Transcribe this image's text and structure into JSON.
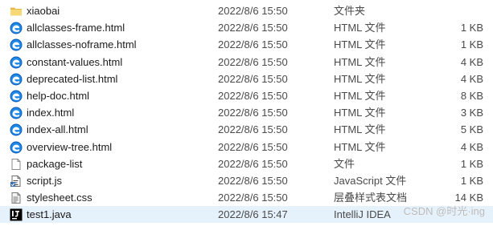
{
  "files": [
    {
      "name": "xiaobai",
      "date": "2022/8/6 15:50",
      "type": "文件夹",
      "size": "",
      "icon": "folder-icon"
    },
    {
      "name": "allclasses-frame.html",
      "date": "2022/8/6 15:50",
      "type": "HTML 文件",
      "size": "1 KB",
      "icon": "edge-html-icon"
    },
    {
      "name": "allclasses-noframe.html",
      "date": "2022/8/6 15:50",
      "type": "HTML 文件",
      "size": "1 KB",
      "icon": "edge-html-icon"
    },
    {
      "name": "constant-values.html",
      "date": "2022/8/6 15:50",
      "type": "HTML 文件",
      "size": "4 KB",
      "icon": "edge-html-icon"
    },
    {
      "name": "deprecated-list.html",
      "date": "2022/8/6 15:50",
      "type": "HTML 文件",
      "size": "4 KB",
      "icon": "edge-html-icon"
    },
    {
      "name": "help-doc.html",
      "date": "2022/8/6 15:50",
      "type": "HTML 文件",
      "size": "8 KB",
      "icon": "edge-html-icon"
    },
    {
      "name": "index.html",
      "date": "2022/8/6 15:50",
      "type": "HTML 文件",
      "size": "3 KB",
      "icon": "edge-html-icon"
    },
    {
      "name": "index-all.html",
      "date": "2022/8/6 15:50",
      "type": "HTML 文件",
      "size": "5 KB",
      "icon": "edge-html-icon"
    },
    {
      "name": "overview-tree.html",
      "date": "2022/8/6 15:50",
      "type": "HTML 文件",
      "size": "4 KB",
      "icon": "edge-html-icon"
    },
    {
      "name": "package-list",
      "date": "2022/8/6 15:50",
      "type": "文件",
      "size": "1 KB",
      "icon": "blank-file-icon"
    },
    {
      "name": "script.js",
      "date": "2022/8/6 15:50",
      "type": "JavaScript 文件",
      "size": "1 KB",
      "icon": "script-file-icon"
    },
    {
      "name": "stylesheet.css",
      "date": "2022/8/6 15:50",
      "type": "层叠样式表文档",
      "size": "14 KB",
      "icon": "css-file-icon"
    },
    {
      "name": "test1.java",
      "date": "2022/8/6 15:47",
      "type": "IntelliJ IDEA",
      "size": "",
      "icon": "intellij-idea-icon"
    }
  ],
  "selected_index": 12,
  "watermark": "CSDN @时光·ing",
  "colors": {
    "selection": "#e5f1fb",
    "folder": "#f8d775",
    "edge_blue": "#1a73e8",
    "text": "#1b1b1b",
    "meta_text": "#4a4a4a"
  }
}
